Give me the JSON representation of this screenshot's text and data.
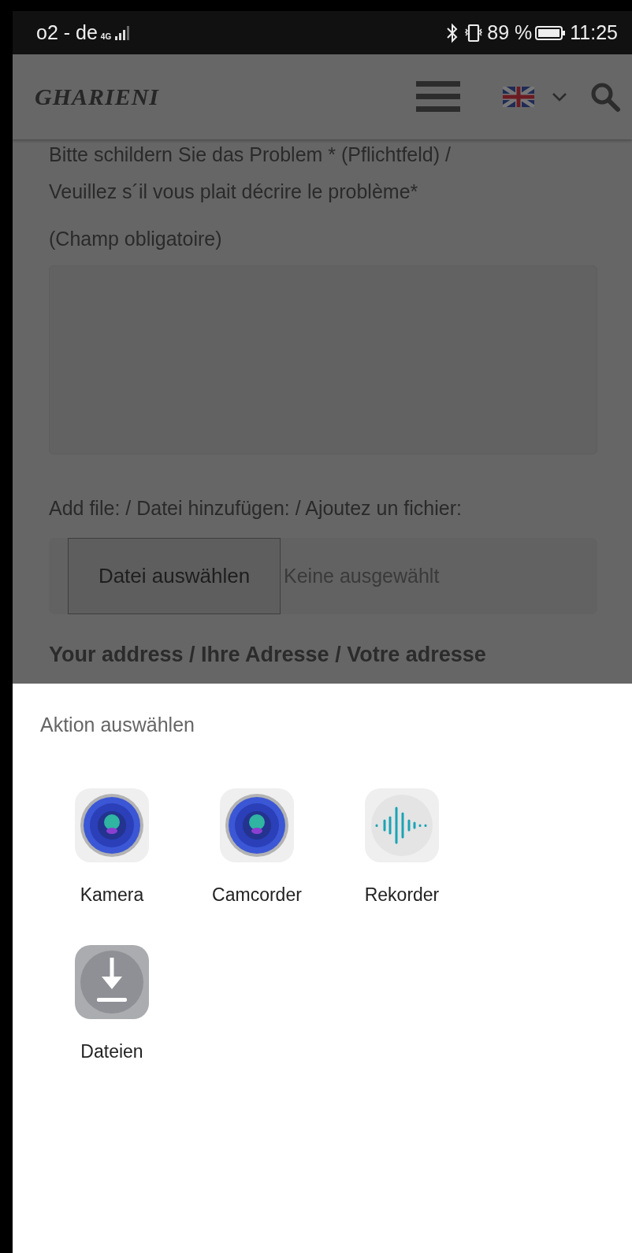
{
  "status_bar": {
    "carrier": "o2 - de",
    "network": "4G",
    "battery": "89 %",
    "time": "11:25"
  },
  "header": {
    "logo": "GHARIENI"
  },
  "form": {
    "problem_label": [
      "Bitte schildern Sie das Problem * (Pflichtfeld) /",
      "Veuillez s´il vous plait décrire le problème*",
      "(Champ obligatoire)"
    ],
    "file_label": "Add file: / Datei hinzufügen: / Ajoutez un fichier:",
    "file_button": "Datei auswählen",
    "file_status": "Keine ausgewählt",
    "address_heading": "Your address / Ihre Adresse / Votre adresse"
  },
  "sheet": {
    "title": "Aktion auswählen",
    "apps": [
      {
        "label": "Kamera",
        "kind": "camera"
      },
      {
        "label": "Camcorder",
        "kind": "camera"
      },
      {
        "label": "Rekorder",
        "kind": "recorder"
      },
      {
        "label": "Dateien",
        "kind": "files"
      }
    ]
  }
}
